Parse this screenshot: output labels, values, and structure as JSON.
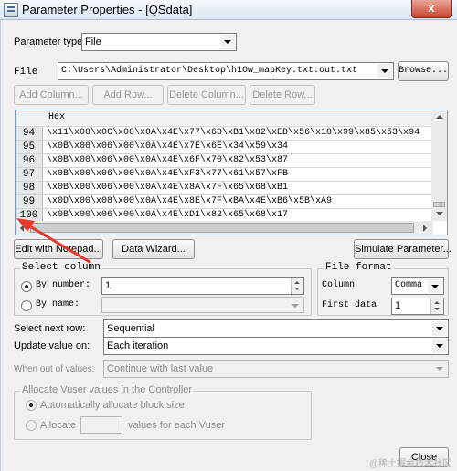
{
  "window": {
    "title": "Parameter Properties - [QSdata]",
    "close_glyph": "x"
  },
  "param_type": {
    "label": "Parameter type:",
    "value": "File"
  },
  "file": {
    "label": "File",
    "path": "C:\\Users\\Administrator\\Desktop\\h1Ow_mapKey.txt.out.txt",
    "browse_label": "Browse..."
  },
  "toolbar": {
    "add_column": "Add Column...",
    "add_row": "Add Row...",
    "delete_column": "Delete Column...",
    "delete_row": "Delete Row..."
  },
  "grid": {
    "column_header": "Hex",
    "rows": [
      {
        "num": "94",
        "hex": "\\x11\\x00\\x0C\\x00\\x0A\\x4E\\x77\\x6D\\xB1\\x82\\xED\\x56\\x10\\x99\\x85\\x53\\x94"
      },
      {
        "num": "95",
        "hex": "\\x0B\\x00\\x06\\x00\\x0A\\x4E\\x7E\\x6E\\x34\\x59\\x34"
      },
      {
        "num": "96",
        "hex": "\\x0B\\x00\\x06\\x00\\x0A\\x4E\\x6F\\x70\\x82\\x53\\x87"
      },
      {
        "num": "97",
        "hex": "\\x0B\\x00\\x06\\x00\\x0A\\x4E\\xF3\\x77\\x61\\x57\\xFB"
      },
      {
        "num": "98",
        "hex": "\\x0B\\x00\\x06\\x00\\x0A\\x4E\\x8A\\x7F\\x65\\x68\\xB1"
      },
      {
        "num": "99",
        "hex": "\\x0D\\x00\\x08\\x00\\x0A\\x4E\\x8E\\x7F\\xBA\\x4E\\xB6\\x5B\\xA9"
      },
      {
        "num": "100",
        "hex": "\\x0B\\x00\\x06\\x00\\x0A\\x4E\\xD1\\x82\\x65\\x68\\x17"
      }
    ]
  },
  "buttons": {
    "edit_notepad": "Edit with Notepad...",
    "data_wizard": "Data Wizard...",
    "simulate": "Simulate Parameter...",
    "close": "Close"
  },
  "select_column": {
    "title": "Select column",
    "by_number_label": "By number:",
    "by_number_value": "1",
    "by_name_label": "By name:"
  },
  "file_format": {
    "title": "File format",
    "column_label": "Column",
    "column_value": "Comma",
    "first_data_label": "First data",
    "first_data_value": "1"
  },
  "select_next_row": {
    "label": "Select next row:",
    "value": "Sequential"
  },
  "update_value_on": {
    "label": "Update value on:",
    "value": "Each iteration"
  },
  "when_out_of_values": {
    "label": "When out of values:",
    "value": "Continue with last value"
  },
  "vuser_alloc": {
    "title": "Allocate Vuser values in the Controller",
    "auto_label": "Automatically allocate block size",
    "allocate_label": "Allocate",
    "values_label": "values for each Vuser"
  },
  "watermark": "@稀土掘金技术社区"
}
